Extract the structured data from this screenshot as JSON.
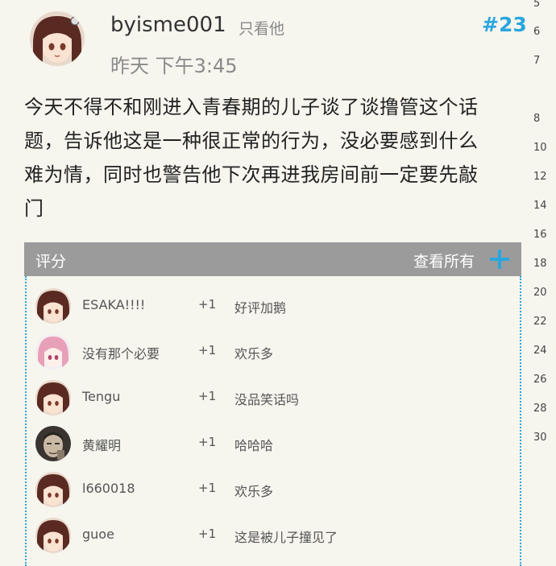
{
  "post": {
    "username": "byisme001",
    "only_see": "只看他",
    "floor": "#23",
    "time": "昨天 下午3:45",
    "avatar": "anime-girl-avatar",
    "content_lines": [
      "今天不得不和刚进入青春期的儿子谈了谈撸管这个话",
      "题，告诉他这是一种很正常的行为，没必要感到什么",
      "难为情，同时也警告他下次再进我房间前一定要先敲",
      "门"
    ]
  },
  "rating": {
    "title": "评分",
    "view_all": "查看所有",
    "plus_icon": "plus-icon",
    "rows": [
      {
        "name": "ESAKA!!!!",
        "score": "+1",
        "comment": "好评加鹅",
        "avatar": "anime-girl-avatar"
      },
      {
        "name": "没有那个必要",
        "score": "+1",
        "comment": "欢乐多",
        "avatar": "pink-hair-anime-avatar"
      },
      {
        "name": "Tengu",
        "score": "+1",
        "comment": "没品笑话吗",
        "avatar": "anime-girl-avatar"
      },
      {
        "name": "黄耀明",
        "score": "+1",
        "comment": "哈哈哈",
        "avatar": "man-photo-avatar"
      },
      {
        "name": "l660018",
        "score": "+1",
        "comment": "欢乐多",
        "avatar": "anime-girl-avatar"
      },
      {
        "name": "guoe",
        "score": "+1",
        "comment": "这是被儿子撞见了",
        "avatar": "anime-girl-avatar"
      }
    ]
  },
  "ruler_numbers": [
    "5",
    "6",
    "7",
    "8",
    "10",
    "12",
    "14",
    "16",
    "18",
    "20",
    "22",
    "24",
    "26",
    "28",
    "30"
  ],
  "colors": {
    "accent": "#2aa6df",
    "header_bar": "#9b9b9b",
    "background": "#f6f5ee"
  }
}
